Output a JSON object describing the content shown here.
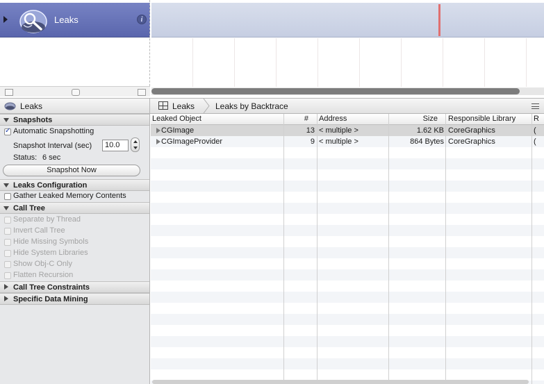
{
  "instrument": {
    "name": "Leaks",
    "info_glyph": "i",
    "icon": "leaks-instrument-icon"
  },
  "jump_bar": {
    "left_label": "Leaks",
    "left_icon": "leaks-small-icon",
    "crumbs": [
      "Leaks",
      "Leaks by Backtrace"
    ],
    "grid_icon": "table-grid-icon",
    "menu_icon": "list-menu-icon"
  },
  "sidebar": {
    "snapshots": {
      "title": "Snapshots",
      "automatic_label": "Automatic Snapshotting",
      "automatic_checked": true,
      "interval_label": "Snapshot Interval (sec)",
      "interval_value": "10.0",
      "status_label": "Status:",
      "status_value": "6 sec",
      "snapshot_now_label": "Snapshot Now"
    },
    "leaks_config": {
      "title": "Leaks Configuration",
      "gather_label": "Gather Leaked Memory Contents",
      "gather_checked": false
    },
    "call_tree": {
      "title": "Call Tree",
      "options": [
        "Separate by Thread",
        "Invert Call Tree",
        "Hide Missing Symbols",
        "Hide System Libraries",
        "Show Obj-C Only",
        "Flatten Recursion"
      ]
    },
    "constraints_title": "Call Tree Constraints",
    "data_mining_title": "Specific Data Mining"
  },
  "table": {
    "columns": [
      "Leaked Object",
      "#",
      "Address",
      "Size",
      "Responsible Library",
      "R"
    ],
    "rows": [
      {
        "object": "CGImage",
        "count": "13",
        "address": "< multiple >",
        "size": "1.62 KB",
        "library": "CoreGraphics",
        "extra": "("
      },
      {
        "object": "CGImageProvider",
        "count": "9",
        "address": "< multiple >",
        "size": "864 Bytes",
        "library": "CoreGraphics",
        "extra": "("
      }
    ]
  },
  "colors": {
    "instrument_row": "#6a75b9",
    "leak_marker": "#e07070",
    "selected_row": "#d6d6d6",
    "stripe": "#f3f5f8"
  }
}
